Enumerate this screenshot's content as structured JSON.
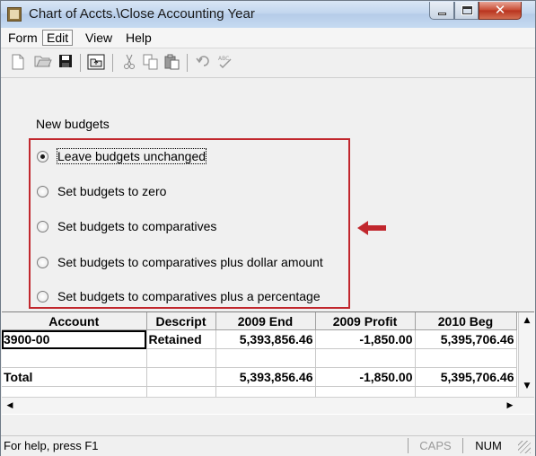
{
  "window": {
    "title": "Chart of Accts.\\Close Accounting Year",
    "controls": {
      "minimize": "",
      "maximize": "",
      "close": "✕"
    }
  },
  "menu": {
    "items": [
      "Form",
      "Edit",
      "View",
      "Help"
    ]
  },
  "toolbar": {
    "icons": [
      "new-document-icon",
      "open-folder-icon",
      "save-icon",
      "up-folder-icon",
      "cut-icon",
      "copy-icon",
      "paste-icon",
      "undo-icon",
      "spellcheck-icon"
    ]
  },
  "form": {
    "section_label": "New budgets",
    "options": [
      {
        "label": "Leave budgets unchanged",
        "checked": true
      },
      {
        "label": "Set budgets to zero",
        "checked": false
      },
      {
        "label": "Set budgets to comparatives",
        "checked": false
      },
      {
        "label": "Set budgets to comparatives plus dollar amount",
        "checked": false
      },
      {
        "label": "Set budgets to comparatives plus a percentage",
        "checked": false
      }
    ],
    "highlight_color": "#c1272d"
  },
  "grid": {
    "columns": [
      "Account",
      "Descript",
      "2009 End",
      "2009 Profit",
      "2010 Beg"
    ],
    "rows": [
      [
        "3900-00",
        "Retained",
        "5,393,856.46",
        "-1,850.00",
        "5,395,706.46"
      ],
      [
        "",
        "",
        "",
        "",
        ""
      ],
      [
        "Total",
        "",
        "5,393,856.46",
        "-1,850.00",
        "5,395,706.46"
      ],
      [
        "",
        "",
        "",
        "",
        ""
      ]
    ]
  },
  "status": {
    "help_text": "For help, press F1",
    "caps": "CAPS",
    "num": "NUM"
  }
}
